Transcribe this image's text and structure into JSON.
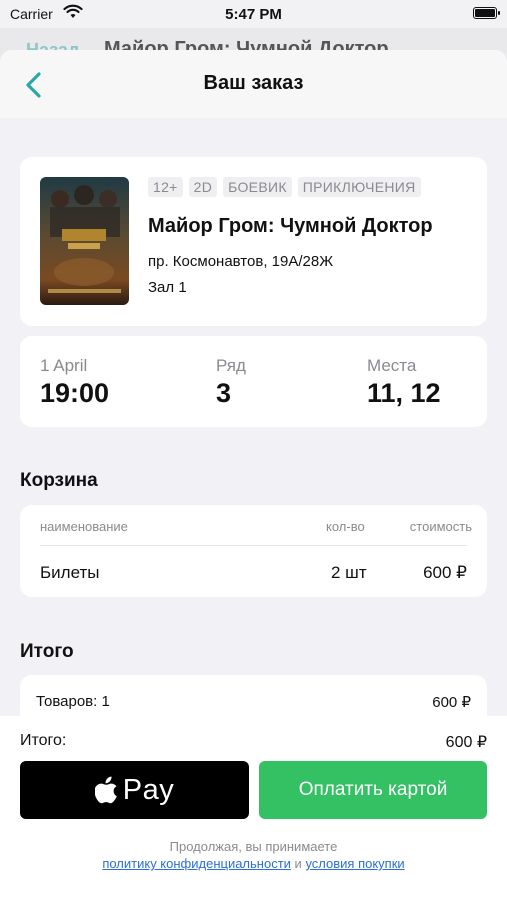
{
  "status_bar": {
    "carrier": "Carrier",
    "time": "5:47 PM"
  },
  "background_screen": {
    "back_label": "Назад",
    "title": "Майор Гром: Чумной Доктор"
  },
  "nav": {
    "title": "Ваш заказ",
    "back_icon": "chevron-left-icon",
    "accent_color": "#2aa8a4"
  },
  "movie": {
    "tags": [
      "12+",
      "2D",
      "БОЕВИК",
      "ПРИКЛЮЧЕНИЯ"
    ],
    "title": "Майор Гром: Чумной Доктор",
    "address": "пр. Космонавтов, 19А/28Ж",
    "hall": "Зал 1"
  },
  "session": {
    "date": "1 April",
    "time": "19:00",
    "row_label": "Ряд",
    "row_value": "3",
    "seats_label": "Места",
    "seats_value": "11, 12"
  },
  "cart": {
    "title": "Корзина",
    "headers": {
      "name": "наименование",
      "qty": "кол-во",
      "cost": "стоимость"
    },
    "rows": [
      {
        "name": "Билеты",
        "qty": "2 шт",
        "cost": "600 ₽"
      }
    ]
  },
  "summary": {
    "title": "Итого",
    "items_label": "Товаров: 1",
    "items_value": "600 ₽"
  },
  "footer": {
    "total_label": "Итого:",
    "total_value": "600 ₽",
    "apple_pay_label": "Pay",
    "card_pay_label": "Оплатить картой",
    "legal_prefix": "Продолжая, вы принимаете",
    "privacy_link": "политику конфиденциальности",
    "and_word": "и",
    "terms_link": "условия покупки",
    "pay_green": "#34c164",
    "link_color": "#2a6fd6"
  }
}
